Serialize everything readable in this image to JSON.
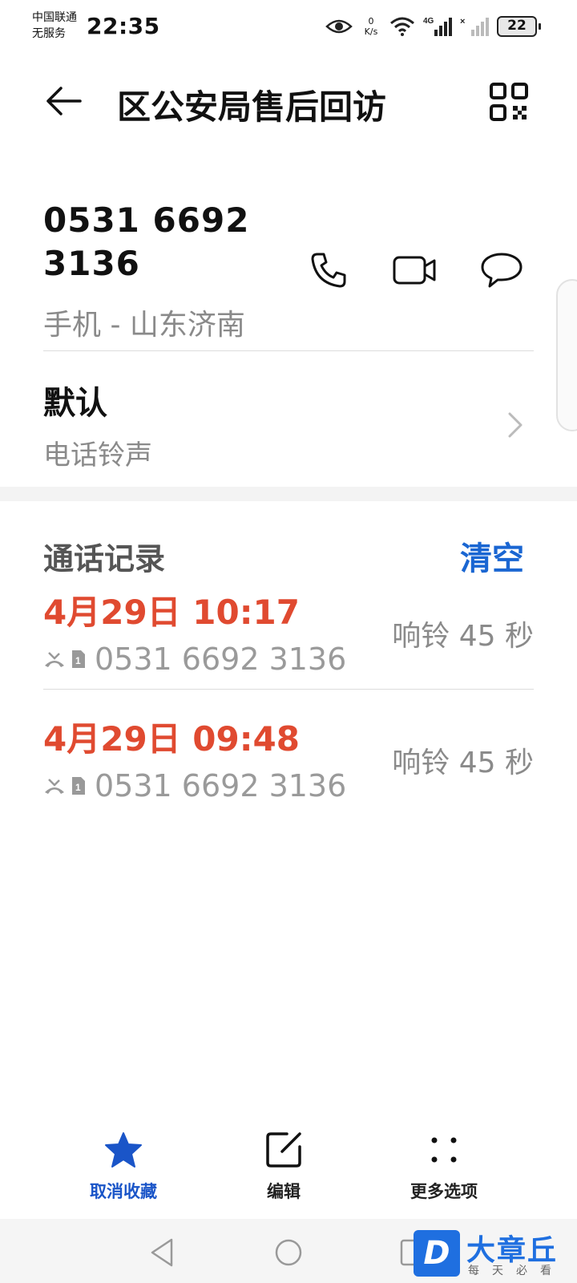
{
  "status_bar": {
    "carrier_line1": "中国联通",
    "carrier_line2": "无服务",
    "time": "22:35",
    "net_speed_value": "0",
    "net_speed_unit": "K/s",
    "battery": "22",
    "icons": [
      "eye-icon",
      "wifi-icon",
      "4g-signal-icon",
      "no-signal-icon",
      "battery-icon"
    ]
  },
  "header": {
    "title": "区公安局售后回访"
  },
  "contact": {
    "number": "0531 6692 3136",
    "location": "手机 - 山东济南"
  },
  "ringtone": {
    "value": "默认",
    "label": "电话铃声"
  },
  "call_log": {
    "title": "通话记录",
    "clear_label": "清空",
    "entries": [
      {
        "time": "4月29日 10:17",
        "number": "0531 6692 3136",
        "duration": "响铃 45 秒"
      },
      {
        "time": "4月29日 09:48",
        "number": "0531 6692 3136",
        "duration": "响铃 45 秒"
      }
    ]
  },
  "bottom_bar": {
    "unfavorite_label": "取消收藏",
    "edit_label": "编辑",
    "more_label": "更多选项"
  },
  "watermark": {
    "logo_letter": "D",
    "name": "大章丘",
    "slogan": "每天必看"
  },
  "colors": {
    "missed_red": "#e04a30",
    "accent_blue": "#1a66d2",
    "secondary_text": "#8a8a8a"
  }
}
